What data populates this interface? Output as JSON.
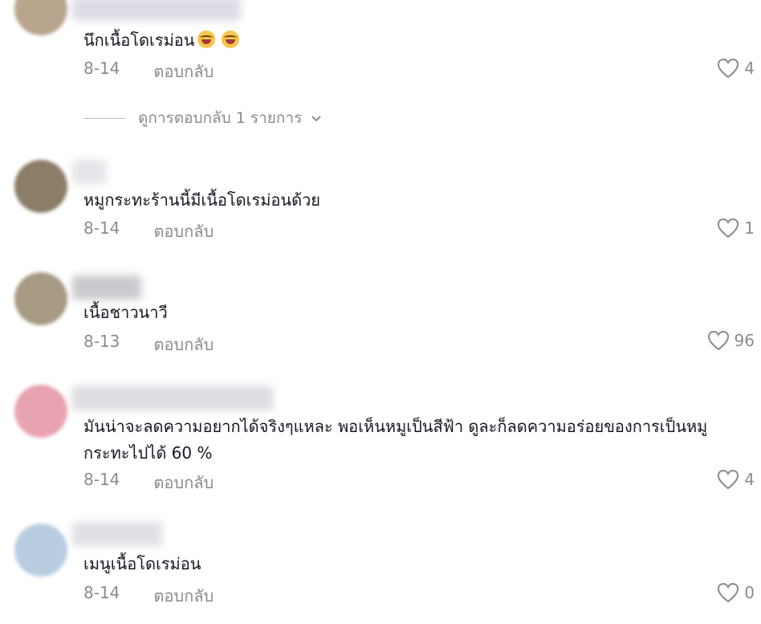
{
  "colors": {
    "text": "#161823",
    "muted": "#8a8b91",
    "background": "#ffffff"
  },
  "comments": [
    {
      "text": "นึกเนื้อโดเรม่อน",
      "emojis": [
        "laughing-crying-emoji",
        "laughing-crying-emoji"
      ],
      "date": "8-14",
      "reply_label": "ตอบกลับ",
      "likes": "4"
    },
    {
      "text": "หมูกระทะร้านนี้มีเนื้อโดเรม่อนด้วย",
      "date": "8-14",
      "reply_label": "ตอบกลับ",
      "likes": "1"
    },
    {
      "text": "เนื้อชาวนาวี",
      "date": "8-13",
      "reply_label": "ตอบกลับ",
      "likes": "96"
    },
    {
      "text": "มันน่าจะลดความอยากได้จริงๆแหละ พอเห็นหมูเป็นสีฟ้า ดูละก็ลดความอร่อยของการเป็นหมูกระทะไปได้ 60 %",
      "date": "8-14",
      "reply_label": "ตอบกลับ",
      "likes": "4"
    },
    {
      "text": "เมนูเนื้อโดเรม่อน",
      "date": "8-14",
      "reply_label": "ตอบกลับ",
      "likes": "0"
    }
  ],
  "view_replies": {
    "label": "ดูการตอบกลับ 1 รายการ"
  },
  "icons": {
    "like": "heart-outline-icon",
    "expand": "chevron-down-icon"
  }
}
